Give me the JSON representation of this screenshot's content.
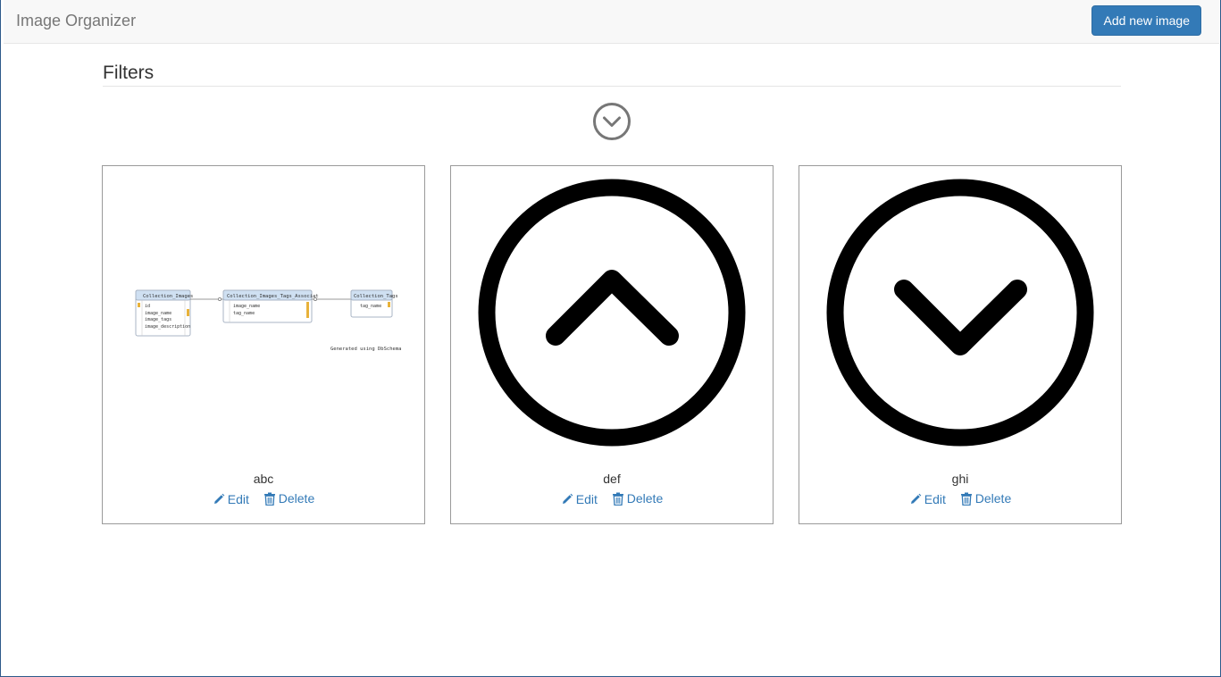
{
  "app": {
    "title": "Image Organizer",
    "add_button_label": "Add new image"
  },
  "filters": {
    "heading": "Filters",
    "toggle_icon": "chevron-circle-down-icon"
  },
  "cards": [
    {
      "name": "abc",
      "edit_label": "Edit",
      "delete_label": "Delete",
      "thumbnail": {
        "type": "database-schema-diagram",
        "tables": [
          {
            "title": "Collection_Images",
            "fields": [
              "id",
              "image_name",
              "image_tags",
              "image_description"
            ]
          },
          {
            "title": "Collection_Images_Tags_Associat",
            "fields": [
              "image_name",
              "tag_name"
            ]
          },
          {
            "title": "Collection_Tags",
            "fields": [
              "tag_name"
            ]
          }
        ],
        "footer_text": "Generated using DbSchema"
      }
    },
    {
      "name": "def",
      "edit_label": "Edit",
      "delete_label": "Delete",
      "thumbnail": {
        "type": "icon",
        "icon": "chevron-circle-up-icon"
      }
    },
    {
      "name": "ghi",
      "edit_label": "Edit",
      "delete_label": "Delete",
      "thumbnail": {
        "type": "icon",
        "icon": "chevron-circle-down-icon"
      }
    }
  ],
  "colors": {
    "primary": "#337ab7",
    "navbar_bg": "#f8f8f8",
    "brand_text": "#777777",
    "card_border": "#9a9a9a"
  }
}
